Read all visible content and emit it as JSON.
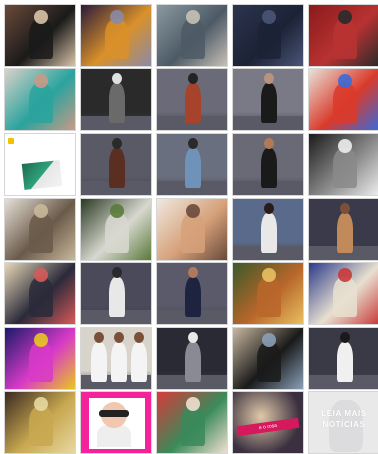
{
  "gallery": {
    "rows": [
      [
        {
          "name": "two-women-portrait",
          "colors": [
            "#6b4a3a",
            "#1a1a1a",
            "#d9c3a8"
          ]
        },
        {
          "name": "planets-collage",
          "colors": [
            "#2a1a3a",
            "#d9912a",
            "#8a8aa8"
          ]
        },
        {
          "name": "street-runner",
          "colors": [
            "#8a9aa0",
            "#4d5a66",
            "#c7c1b5"
          ]
        },
        {
          "name": "dark-backpack",
          "colors": [
            "#2c3550",
            "#1c2236",
            "#4a5576"
          ]
        },
        {
          "name": "staircase-man",
          "colors": [
            "#8a1a1a",
            "#b83232",
            "#2a2a2a"
          ]
        }
      ],
      [
        {
          "name": "lying-models",
          "colors": [
            "#d9d1c9",
            "#2aa39e",
            "#c99a86"
          ]
        },
        {
          "name": "runway-group-bw",
          "colors": [
            "#2a2a2a",
            "#6a6a6a",
            "#e0e0e0"
          ]
        },
        {
          "name": "runway-red-jacket",
          "colors": [
            "#6a6a78",
            "#a7432a",
            "#232323"
          ]
        },
        {
          "name": "runway-mesh-top",
          "colors": [
            "#7a7a86",
            "#1a1a1a",
            "#b89480"
          ]
        },
        {
          "name": "group-colorful",
          "colors": [
            "#e8e2d9",
            "#d93a2a",
            "#3a6ad9"
          ]
        }
      ],
      [
        {
          "name": "app-card",
          "colors": [
            "#ffffff",
            "#1d6b53",
            "#f2c200"
          ]
        },
        {
          "name": "runway-leather-coat",
          "colors": [
            "#5a5a66",
            "#5a2f22",
            "#2a2a2a"
          ]
        },
        {
          "name": "runway-denim",
          "colors": [
            "#6a6f80",
            "#6f93b8",
            "#2a2a2a"
          ]
        },
        {
          "name": "runway-black-dress",
          "colors": [
            "#6a6a76",
            "#1a1a1a",
            "#b07a5a"
          ]
        },
        {
          "name": "smoke-tree-bw",
          "colors": [
            "#1c1c1c",
            "#8a8a8a",
            "#ededed"
          ]
        }
      ],
      [
        {
          "name": "store-front",
          "colors": [
            "#e6e0d6",
            "#6a5a4a",
            "#c8b89a"
          ]
        },
        {
          "name": "building-green",
          "colors": [
            "#2a3a22",
            "#d8d8d0",
            "#5a7a3a"
          ]
        },
        {
          "name": "sparkle-face",
          "colors": [
            "#f0e8e0",
            "#d6a17a",
            "#6a4a3a"
          ]
        },
        {
          "name": "runway-white-top",
          "colors": [
            "#5a6a8a",
            "#e8e8e8",
            "#2a1a1a"
          ]
        },
        {
          "name": "runway-safari",
          "colors": [
            "#3a3a4a",
            "#c08a5a",
            "#7a5038"
          ]
        }
      ],
      [
        {
          "name": "geometric-frame",
          "colors": [
            "#e8d8b8",
            "#2a2a3a",
            "#d85a5a"
          ]
        },
        {
          "name": "runway-white-suit",
          "colors": [
            "#4a4a5a",
            "#e8e8e8",
            "#2a2a2a"
          ]
        },
        {
          "name": "runway-navy-dress",
          "colors": [
            "#5a5a6a",
            "#1e2440",
            "#b07a5a"
          ]
        },
        {
          "name": "burger",
          "colors": [
            "#3a5a2a",
            "#b8662a",
            "#e8c060"
          ]
        },
        {
          "name": "still-life-blue",
          "colors": [
            "#2a3a8a",
            "#e8e0d0",
            "#c83a3a"
          ]
        }
      ],
      [
        {
          "name": "neon-basket",
          "colors": [
            "#1a1a6a",
            "#d83ac8",
            "#e8c820"
          ]
        },
        {
          "name": "runway-trio-white",
          "colors": [
            "#d8d4cc",
            "#f4f4f4",
            "#8a8a8a"
          ]
        },
        {
          "name": "runway-grey-coat",
          "colors": [
            "#2a2a34",
            "#8a8a94",
            "#e8e8e8"
          ]
        },
        {
          "name": "desert-woman",
          "colors": [
            "#c8b8a0",
            "#1a1a1a",
            "#8aa0b8"
          ]
        },
        {
          "name": "runway-white-tee",
          "colors": [
            "#3a3a46",
            "#f0f0f0",
            "#1a1a1a"
          ]
        }
      ],
      [
        {
          "name": "blonde-gold",
          "colors": [
            "#3a2a22",
            "#c8a850",
            "#e8d8a0"
          ]
        },
        {
          "name": "pink-magazine",
          "colors": [
            "#f4239b",
            "#ffffff",
            "#1a1a1a"
          ]
        },
        {
          "name": "palm-red",
          "colors": [
            "#d83a3a",
            "#3a8a5a",
            "#f0e0d0"
          ]
        },
        {
          "name": "rosa-banner",
          "colors": [
            "#3a3040",
            "#d6195c",
            "#e0c8a8"
          ]
        },
        {
          "name": "leia-mais",
          "colors": [
            "#e9e9ea",
            "#ffffff",
            "#dcdcde"
          ]
        }
      ]
    ],
    "banner_text": "LEIA MAIS\nNOTÍCIAS",
    "rosa_text": "e o rosa"
  }
}
